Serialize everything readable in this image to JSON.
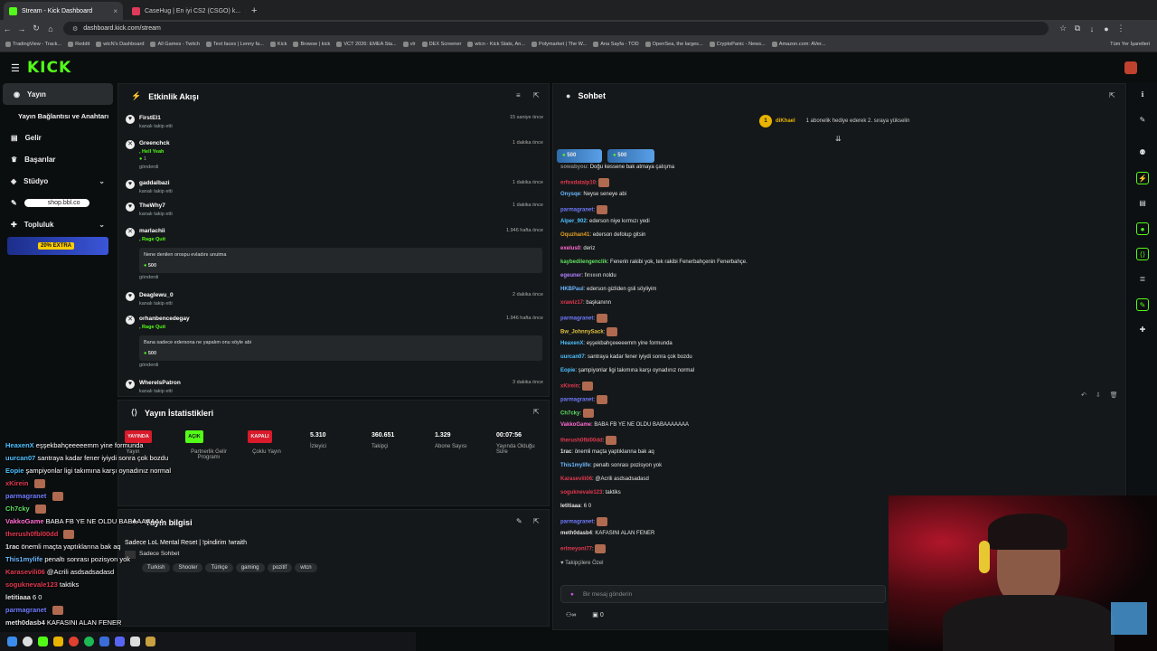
{
  "browser": {
    "tabs": [
      {
        "title": "Stream - Kick Dashboard",
        "color": "#53fc18"
      },
      {
        "title": "CaseHug | En iyi CS2 (CSGO) k...",
        "color": "#e03a5a"
      }
    ],
    "url": "dashboard.kick.com/stream",
    "bookmarks": [
      "TradingView - Track...",
      "Reddit",
      "wtcN's Dashboard",
      "All Games - Twitch",
      "Text faces | Lenny fa...",
      "Kick",
      "Browse | kick",
      "VCT 2026: EMEA Sta...",
      "vlr",
      "DEX Screener",
      "wtcn - Kick Stats, An...",
      "Polymarket | The W...",
      "Ana Sayfa - TOD",
      "OpenSea, the larges...",
      "CryptoPanic - News...",
      "Amazon.com: AVer..."
    ],
    "bookmarks_all": "Tüm Yer İşaretleri"
  },
  "app": {
    "logo": "KICK"
  },
  "sidebar": {
    "items": [
      {
        "label": "Yayın"
      },
      {
        "label": "Yayın Bağlantısı ve Anahtarı"
      },
      {
        "label": "Gelir"
      },
      {
        "label": "Başarılar"
      },
      {
        "label": "Stüdyo"
      },
      {
        "label": "shop.bbl.co"
      },
      {
        "label": "Topluluk"
      }
    ],
    "promo": "20% EXTRA"
  },
  "activity": {
    "title": "Etkinlik Akışı",
    "events": [
      {
        "name": "FirstEl1",
        "sub": "kanalı takip etti",
        "time": "15 saniye önce"
      },
      {
        "name": "Greenchck",
        "sub": ", Hell Yeah",
        "time": "1 dakika önce",
        "extra": "1",
        "sent": "gönderdi"
      },
      {
        "name": "gaddalbazi",
        "sub": "kanalı takip etti",
        "time": "1 dakika önce"
      },
      {
        "name": "TheWhy7",
        "sub": "kanalı takip etti",
        "time": "1 dakika önce"
      },
      {
        "name": "marlachii",
        "sub": ", Rage Quit",
        "time": "1.946 hafta önce",
        "message": "Nene denilen orospu evladını unutma",
        "amount": "500",
        "sent": "gönderdi"
      },
      {
        "name": "Deaglewu_0",
        "sub": "kanalı takip etti",
        "time": "2 dakika önce"
      },
      {
        "name": "orhanbencedegay",
        "sub": ", Rage Quit",
        "time": "1.946 hafta önce",
        "message": "Bana sadece edersona ne yapalım onu söyle abi",
        "amount": "500",
        "sent": "gönderdi"
      },
      {
        "name": "WherelsPatron",
        "sub": "kanalı takip etti",
        "time": "3 dakika önce"
      }
    ]
  },
  "stats": {
    "title": "Yayın İstatistikleri",
    "badges": [
      "YAYINDA",
      "AÇIK",
      "KAPALI"
    ],
    "labels": [
      "Yayın",
      "Partnerlik Gelir Programı",
      "Çoklu Yayın"
    ],
    "values": [
      {
        "value": "5.310",
        "label": "İzleyici"
      },
      {
        "value": "360.651",
        "label": "Takipçi"
      },
      {
        "value": "1.329",
        "label": "Abone Sayısı"
      },
      {
        "value": "00:07:56",
        "label": "Yayında Olduğu Süre"
      }
    ]
  },
  "info": {
    "title": "Yayın bilgisi",
    "stream_title": "Sadece LoL Mental Reset | !pindirim !wraith",
    "category": "Sadece Sohbet",
    "tags": [
      "Turkish",
      "Shooter",
      "Türkçe",
      "gaming",
      "pozitif",
      "wtcn"
    ]
  },
  "chat": {
    "title": "Sohbet",
    "pinned_user": "diKhael",
    "pinned_text": "1 abonelik hediye ederek 2. sıraya yükselin",
    "pinned_rank": "1",
    "tip_amounts": [
      "500",
      "500"
    ],
    "messages": [
      {
        "user": "sowabyou",
        "color": "#888",
        "text": "Doğu kessene bak atmaya çalışma"
      },
      {
        "user": "erfoxdatalp10",
        "color": "#e0384f",
        "text": ""
      },
      {
        "user": "Onysqe",
        "color": "#6bb8ff",
        "text": "Neyse seneye abi"
      },
      {
        "user": "parmagranet",
        "color": "#6f7bff",
        "text": ""
      },
      {
        "user": "Alper_902",
        "color": "#4ec0ff",
        "text": "ederson niye kırmızı yedi"
      },
      {
        "user": "Oquzhan41",
        "color": "#e0a020",
        "text": "ederson defolup gitsin"
      },
      {
        "user": "exelus0",
        "color": "#ff6bd0",
        "text": "deriz"
      },
      {
        "user": "kaybedilengenclik",
        "color": "#60e060",
        "text": "Fenerin rakibi yok, tek rakibi Fenerbahçenin Fenerbahçe."
      },
      {
        "user": "egeuner",
        "color": "#b07fff",
        "text": "fırıııııın noldu"
      },
      {
        "user": "HKBPaul",
        "color": "#6bb8ff",
        "text": "ederson gizliden gsli söyliyim"
      },
      {
        "user": "xrawiz17",
        "color": "#e0384f",
        "text": "başkanınn"
      },
      {
        "user": "parmagranet",
        "color": "#6f7bff",
        "text": ""
      },
      {
        "user": "Bw_JohnnySack",
        "color": "#e0c040",
        "text": ""
      },
      {
        "user": "HeaxenX",
        "color": "#4ec0ff",
        "text": "eşşekbahçeeeeemm yine formunda"
      },
      {
        "user": "uurcan07",
        "color": "#4ec0ff",
        "text": "santraya kadar fener iyiydi sonra çok bozdu"
      },
      {
        "user": "Eopie",
        "color": "#4ec0ff",
        "text": "şampiyonlar ligi takımına karşı oynadınız normal"
      },
      {
        "user": "xKirein",
        "color": "#e0384f",
        "text": ""
      },
      {
        "user": "parmagranet",
        "color": "#6f7bff",
        "text": ""
      },
      {
        "user": "Ch7cky",
        "color": "#60e060",
        "text": ""
      },
      {
        "user": "VakkoGame",
        "color": "#ff6bd0",
        "text": "BABA FB YE NE OLDU BABAAAAAAA"
      },
      {
        "user": "therush0fbl00dd",
        "color": "#e0384f",
        "text": ""
      },
      {
        "user": "1rac",
        "color": "#e0e0e0",
        "text": "önemli maçta yaptıklarına bak aq"
      },
      {
        "user": "This1mylife",
        "color": "#6bb8ff",
        "text": "penaltı sonrası pozisyon yok"
      },
      {
        "user": "Karasevili06",
        "color": "#e0384f",
        "text": "@Acrili asdsadsadasd"
      },
      {
        "user": "soguknevale123",
        "color": "#e0384f",
        "text": "taktiks"
      },
      {
        "user": "letitiaaa",
        "color": "#e0e0e0",
        "text": "6 0"
      },
      {
        "user": "parmagranet",
        "color": "#6f7bff",
        "text": ""
      },
      {
        "user": "meth0dasb4",
        "color": "#e0e0e0",
        "text": "KAFASINI ALAN FENER"
      },
      {
        "user": "erlmeyoni77",
        "color": "#e0384f",
        "text": ""
      }
    ],
    "follower_only": "Takipçilere Özel",
    "input_placeholder": "Bir mesaj gönderin",
    "footer_count": "0"
  },
  "overlay": [
    {
      "user": "HeaxenX",
      "color": "#4ec0ff",
      "text": "eşşekbahçeeeeemm yine formunda"
    },
    {
      "user": "uurcan07",
      "color": "#4ec0ff",
      "text": "santraya kadar fener iyiydi sonra çok bozdu"
    },
    {
      "user": "Eopie",
      "color": "#4ec0ff",
      "text": "şampiyonlar ligi takımına karşı oynadınız normal"
    },
    {
      "user": "xKirein",
      "color": "#e0384f",
      "text": ""
    },
    {
      "user": "parmagranet",
      "color": "#6f7bff",
      "text": ""
    },
    {
      "user": "Ch7cky",
      "color": "#60e060",
      "text": ""
    },
    {
      "user": "VakkoGame",
      "color": "#ff6bd0",
      "text": "BABA FB YE NE OLDU BABAAAAAAA"
    },
    {
      "user": "therush0fbl00dd",
      "color": "#e0384f",
      "text": ""
    },
    {
      "user": "1rac",
      "color": "#e0e0e0",
      "text": "önemli maçta yaptıklarına bak aq"
    },
    {
      "user": "This1mylife",
      "color": "#6bb8ff",
      "text": "penaltı sonrası pozisyon yok"
    },
    {
      "user": "Karasevili06",
      "color": "#e0384f",
      "text": "@Acrili asdsadsadasd"
    },
    {
      "user": "soguknevale123",
      "color": "#e0384f",
      "text": "taktiks"
    },
    {
      "user": "letitiaaa",
      "color": "#e0e0e0",
      "text": "6 0"
    },
    {
      "user": "parmagranet",
      "color": "#6f7bff",
      "text": ""
    },
    {
      "user": "meth0dasb4",
      "color": "#e0e0e0",
      "text": "KAFASINI ALAN FENER"
    }
  ]
}
